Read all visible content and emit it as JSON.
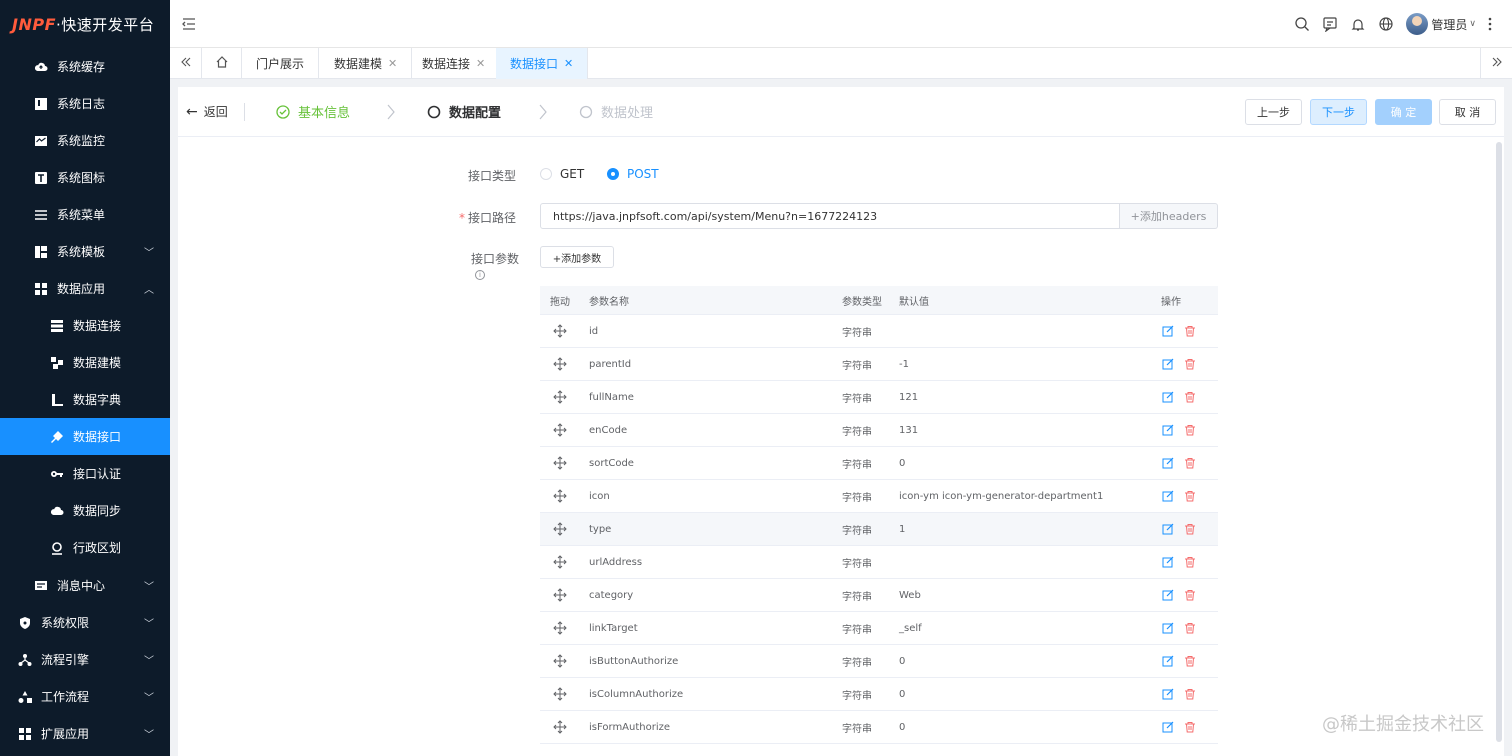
{
  "app": {
    "brand": "JNPF",
    "brand_rest": "·快速开发平台"
  },
  "sidebar": {
    "items": [
      {
        "label": "系统缓存",
        "icon": "cloud-icon"
      },
      {
        "label": "系统日志",
        "icon": "log-icon"
      },
      {
        "label": "系统监控",
        "icon": "monitor-icon"
      },
      {
        "label": "系统图标",
        "icon": "icon-text-icon"
      },
      {
        "label": "系统菜单",
        "icon": "menu-list-icon"
      },
      {
        "label": "系统模板",
        "icon": "template-icon"
      },
      {
        "label": "数据应用",
        "icon": "apps-icon"
      },
      {
        "label": "数据连接",
        "icon": "database-icon"
      },
      {
        "label": "数据建模",
        "icon": "model-icon"
      },
      {
        "label": "数据字典",
        "icon": "book-icon"
      },
      {
        "label": "数据接口",
        "icon": "plug-icon"
      },
      {
        "label": "接口认证",
        "icon": "key-icon"
      },
      {
        "label": "数据同步",
        "icon": "cloud-sync-icon"
      },
      {
        "label": "行政区划",
        "icon": "location-icon"
      },
      {
        "label": "消息中心",
        "icon": "message-icon"
      },
      {
        "label": "系统权限",
        "icon": "shield-icon"
      },
      {
        "label": "流程引擎",
        "icon": "flow-icon"
      },
      {
        "label": "工作流程",
        "icon": "workflow-icon"
      },
      {
        "label": "扩展应用",
        "icon": "extension-icon"
      }
    ]
  },
  "header": {
    "user_name": "管理员"
  },
  "tabs": [
    {
      "label": "门户展示"
    },
    {
      "label": "数据建模"
    },
    {
      "label": "数据连接"
    },
    {
      "label": "数据接口"
    }
  ],
  "steps": {
    "back_label": "返回",
    "items": [
      {
        "label": "基本信息",
        "state": "done"
      },
      {
        "label": "数据配置",
        "state": "current"
      },
      {
        "label": "数据处理",
        "state": "pending"
      }
    ],
    "buttons": {
      "prev": "上一步",
      "next": "下一步",
      "confirm": "确 定",
      "cancel": "取 消"
    }
  },
  "form": {
    "type_label": "接口类型",
    "methods": [
      "GET",
      "POST"
    ],
    "selected_method": "POST",
    "path_label": "接口路径",
    "path_value": "https://java.jnpfsoft.com/api/system/Menu?n=1677224123",
    "add_headers": "+添加headers",
    "params_label": "接口参数",
    "add_param": "+添加参数"
  },
  "table": {
    "headers": {
      "drag": "拖动",
      "name": "参数名称",
      "type": "参数类型",
      "default": "默认值",
      "ops": "操作"
    },
    "rows": [
      {
        "name": "id",
        "type": "字符串",
        "default": ""
      },
      {
        "name": "parentId",
        "type": "字符串",
        "default": "-1"
      },
      {
        "name": "fullName",
        "type": "字符串",
        "default": "121"
      },
      {
        "name": "enCode",
        "type": "字符串",
        "default": "131"
      },
      {
        "name": "sortCode",
        "type": "字符串",
        "default": "0"
      },
      {
        "name": "icon",
        "type": "字符串",
        "default": "icon-ym icon-ym-generator-department1"
      },
      {
        "name": "type",
        "type": "字符串",
        "default": "1"
      },
      {
        "name": "urlAddress",
        "type": "字符串",
        "default": ""
      },
      {
        "name": "category",
        "type": "字符串",
        "default": "Web"
      },
      {
        "name": "linkTarget",
        "type": "字符串",
        "default": "_self"
      },
      {
        "name": "isButtonAuthorize",
        "type": "字符串",
        "default": "0"
      },
      {
        "name": "isColumnAuthorize",
        "type": "字符串",
        "default": "0"
      },
      {
        "name": "isFormAuthorize",
        "type": "字符串",
        "default": "0"
      }
    ]
  },
  "watermark": "@稀土掘金技术社区",
  "colors": {
    "primary": "#1890ff",
    "sidebar_bg": "#0d1b2a",
    "success": "#67c23a",
    "danger": "#f56c6c"
  }
}
